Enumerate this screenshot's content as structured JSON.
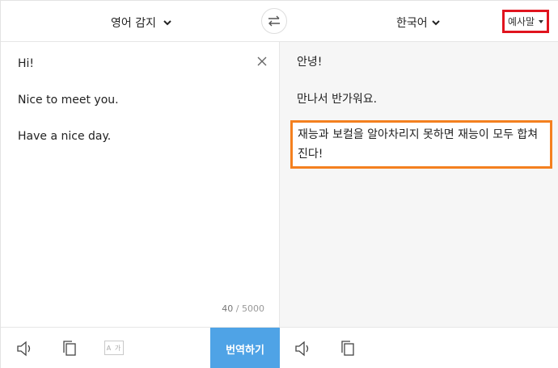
{
  "header": {
    "source_language": "영어 감지",
    "target_language": "한국어",
    "example_button": "예사말"
  },
  "source": {
    "lines": [
      "Hi!",
      "Nice to meet you.",
      "Have a nice day."
    ],
    "char_count": "40",
    "char_limit": "/ 5000"
  },
  "target": {
    "lines": [
      "안녕!",
      "만나서 반가워요."
    ],
    "highlighted_text": "재능과 보컬을 알아차리지 못하면 재능이 모두 합쳐진다!"
  },
  "footer": {
    "font_icon_text": "A 가",
    "translate_button": "번역하기"
  },
  "colors": {
    "translate_button_bg": "#4fa3e6",
    "example_highlight": "#e0141e",
    "text_highlight": "#f4801f"
  }
}
